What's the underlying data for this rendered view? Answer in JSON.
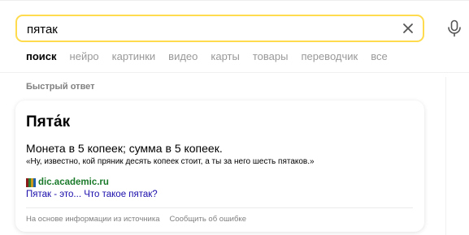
{
  "search": {
    "query": "пятак",
    "clear_icon": "close-icon",
    "voice_icon": "microphone-icon"
  },
  "tabs": [
    {
      "label": "поиск",
      "active": true
    },
    {
      "label": "нейро"
    },
    {
      "label": "картинки"
    },
    {
      "label": "видео"
    },
    {
      "label": "карты"
    },
    {
      "label": "товары"
    },
    {
      "label": "переводчик"
    },
    {
      "label": "все"
    }
  ],
  "quick_answer": {
    "section_label": "Быстрый ответ",
    "title": "Пята́к",
    "definition": "Монета в 5 копеек; сумма в 5 копеек.",
    "example": "«Ну, известно, кой пряник десять копеек стоит, а ты за него шесть пятаков.»",
    "source": {
      "domain": "dic.academic.ru",
      "link_text": "Пятак - это... Что такое пятак?",
      "favicon_colors": [
        "#8b1a1a",
        "#2e7d32",
        "#c99a1c",
        "#1f5fa8"
      ]
    },
    "footer": {
      "based_on": "На основе информации из источника",
      "report": "Сообщить об ошибке"
    }
  },
  "colors": {
    "search_border": "#ffdb4d",
    "link": "#1a0dab",
    "source_green": "#1a7a2a",
    "muted": "#999999"
  }
}
